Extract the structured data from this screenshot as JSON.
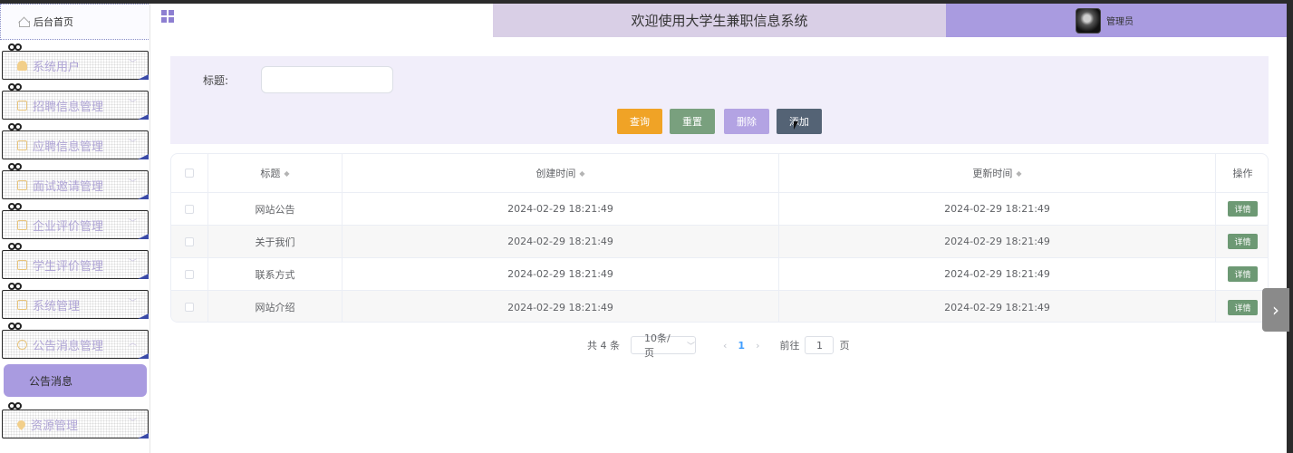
{
  "header": {
    "title": "欢迎使用大学生兼职信息系统",
    "username": "管理员"
  },
  "sidebar": {
    "home_label": "后台首页",
    "items": [
      {
        "label": "系统用户",
        "icon": "user-icon"
      },
      {
        "label": "招聘信息管理",
        "icon": "document-icon"
      },
      {
        "label": "应聘信息管理",
        "icon": "document-icon"
      },
      {
        "label": "面试邀请管理",
        "icon": "document-icon"
      },
      {
        "label": "企业评价管理",
        "icon": "document-icon"
      },
      {
        "label": "学生评价管理",
        "icon": "document-icon"
      },
      {
        "label": "系统管理",
        "icon": "checklist-icon"
      },
      {
        "label": "公告消息管理",
        "icon": "info-icon"
      },
      {
        "label": "资源管理",
        "icon": "location-icon"
      }
    ],
    "submenu_label": "公告消息"
  },
  "search": {
    "label": "标题:",
    "placeholder": "",
    "buttons": {
      "query": "查询",
      "reset": "重置",
      "delete": "删除",
      "add": "添加"
    }
  },
  "table": {
    "headers": [
      "标题",
      "创建时间",
      "更新时间",
      "操作"
    ],
    "action_label": "详情",
    "rows": [
      {
        "title": "网站公告",
        "created": "2024-02-29 18:21:49",
        "updated": "2024-02-29 18:21:49"
      },
      {
        "title": "关于我们",
        "created": "2024-02-29 18:21:49",
        "updated": "2024-02-29 18:21:49"
      },
      {
        "title": "联系方式",
        "created": "2024-02-29 18:21:49",
        "updated": "2024-02-29 18:21:49"
      },
      {
        "title": "网站介绍",
        "created": "2024-02-29 18:21:49",
        "updated": "2024-02-29 18:21:49"
      }
    ]
  },
  "pagination": {
    "total": "共 4 条",
    "page_size": "10条/页",
    "current_page": "1",
    "goto_label": "前往",
    "goto_value": "1",
    "page_unit": "页"
  },
  "colors": {
    "accent": "#a99be0",
    "header_title_bg": "#d9cfe6",
    "query_button": "#f0a326",
    "reset_button": "#79a07e",
    "delete_button": "#b3a3e3",
    "add_button": "#546375",
    "detail_button": "#6d9974"
  }
}
